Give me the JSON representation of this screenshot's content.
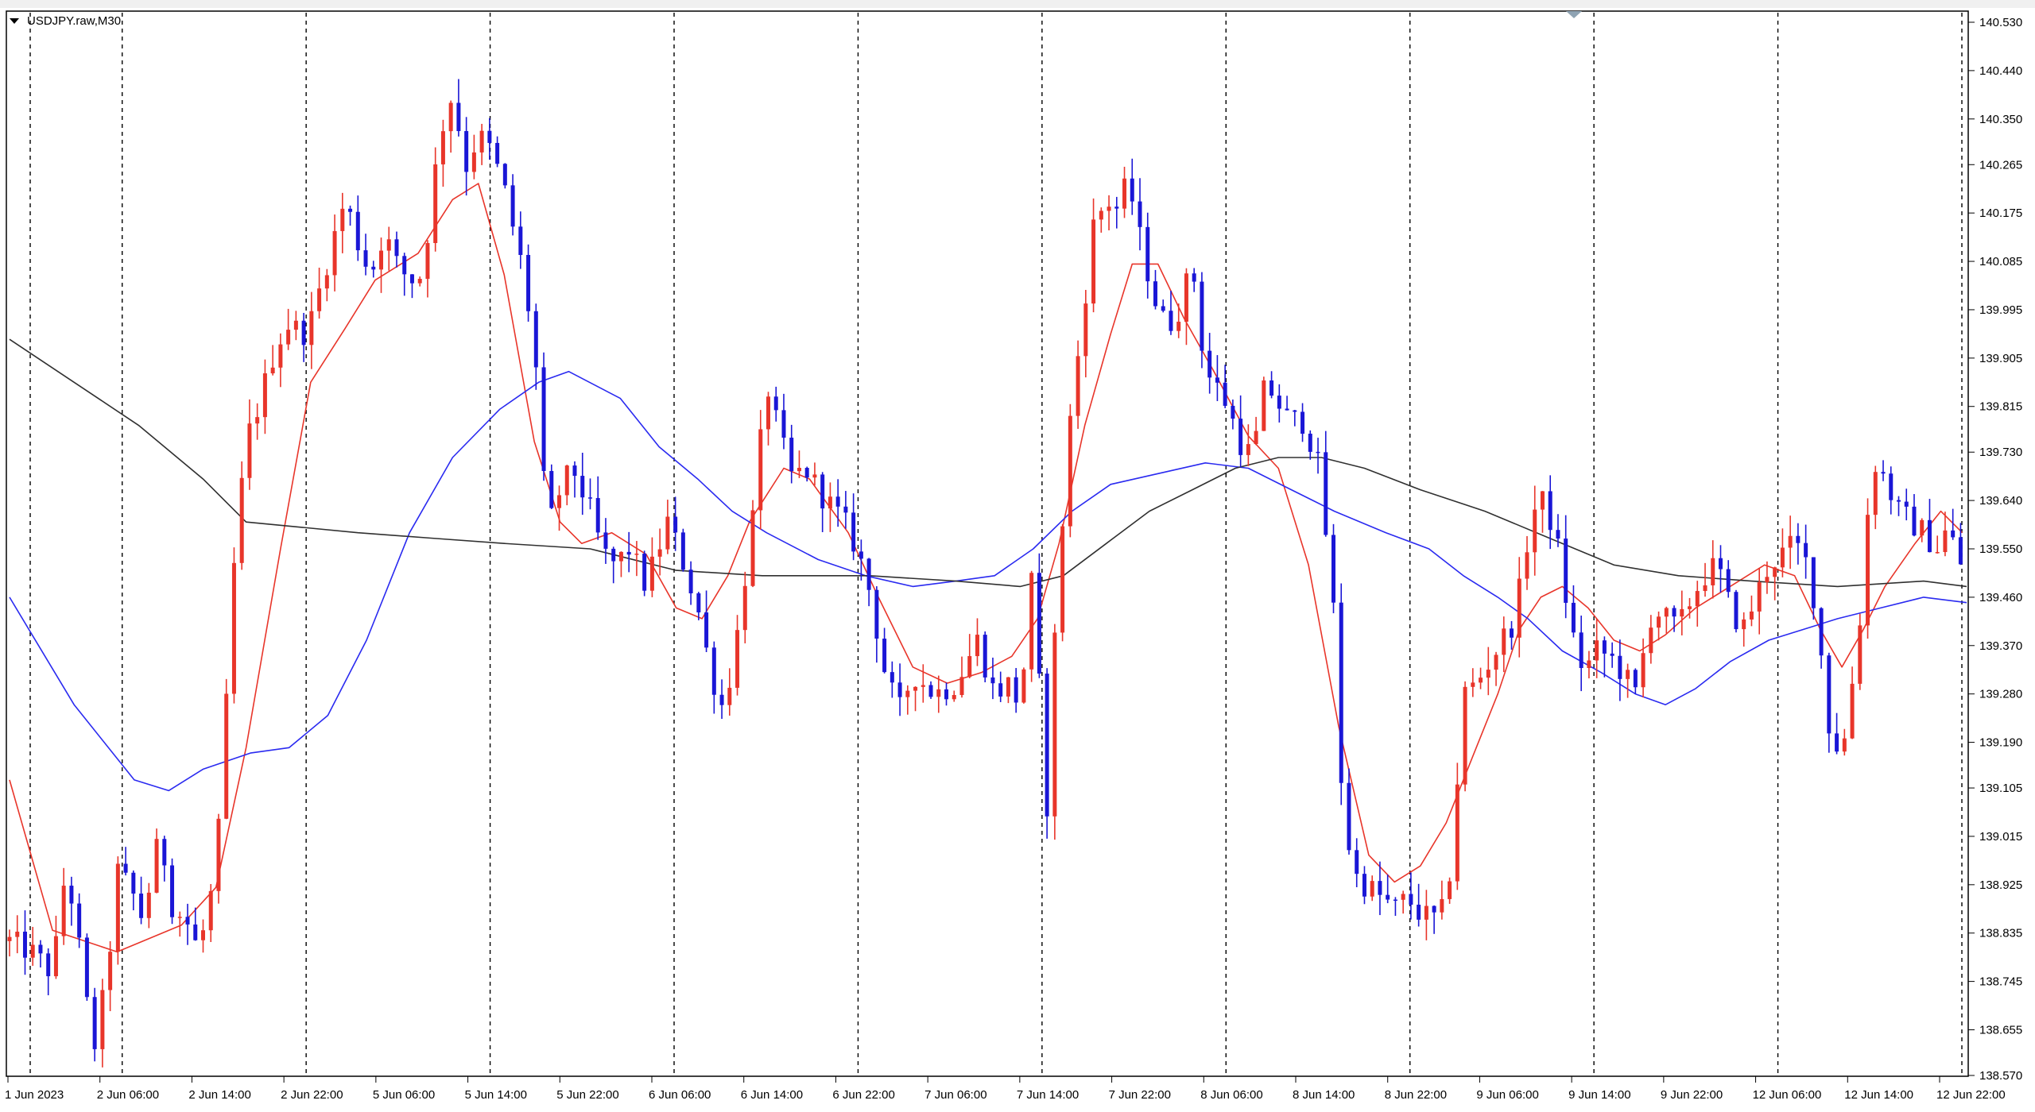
{
  "window": {
    "symbol_title": "USDJPY.raw,M30"
  },
  "colors": {
    "bull": "#e8352a",
    "bear": "#1a16d6",
    "ma_red": "#e8352a",
    "ma_blue": "#2a2af0",
    "ma_black": "#303030",
    "grid": "#000000",
    "background": "#ffffff"
  },
  "chart_data": {
    "type": "candlestick",
    "symbol": "USDJPY.raw",
    "timeframe": "M30",
    "ylim": [
      138.57,
      140.53
    ],
    "grid": false,
    "y_ticks": [
      "140.530",
      "140.440",
      "140.350",
      "140.265",
      "140.175",
      "140.085",
      "139.995",
      "139.905",
      "139.815",
      "139.730",
      "139.640",
      "139.550",
      "139.460",
      "139.370",
      "139.280",
      "139.190",
      "139.105",
      "139.015",
      "138.925",
      "138.835",
      "138.745",
      "138.655",
      "138.570"
    ],
    "x_ticks": [
      "1 Jun 2023",
      "2 Jun 06:00",
      "2 Jun 14:00",
      "2 Jun 22:00",
      "5 Jun 06:00",
      "5 Jun 14:00",
      "5 Jun 22:00",
      "6 Jun 06:00",
      "6 Jun 14:00",
      "6 Jun 22:00",
      "7 Jun 06:00",
      "7 Jun 14:00",
      "7 Jun 22:00",
      "8 Jun 06:00",
      "8 Jun 14:00",
      "8 Jun 22:00",
      "9 Jun 06:00",
      "9 Jun 14:00",
      "9 Jun 22:00",
      "12 Jun 06:00",
      "12 Jun 14:00",
      "12 Jun 22:00"
    ],
    "period_separators": [
      "1 Jun 2023",
      "2 Jun 06:00",
      "2 Jun 22:00",
      "5 Jun 14:00",
      "6 Jun 06:00",
      "6 Jun 22:00",
      "7 Jun 14:00",
      "8 Jun 06:00",
      "8 Jun 22:00",
      "9 Jun 14:00",
      "12 Jun 06:00",
      "12 Jun 22:00"
    ],
    "close_path": [
      [
        0,
        138.82
      ],
      [
        10,
        138.8
      ],
      [
        20,
        138.76
      ],
      [
        26,
        138.95
      ],
      [
        30,
        138.88
      ],
      [
        36,
        138.7
      ],
      [
        40,
        138.62
      ],
      [
        46,
        138.78
      ],
      [
        50,
        138.95
      ],
      [
        56,
        138.92
      ],
      [
        62,
        138.86
      ],
      [
        70,
        139.02
      ],
      [
        76,
        138.88
      ],
      [
        82,
        138.86
      ],
      [
        88,
        138.8
      ],
      [
        96,
        138.95
      ],
      [
        100,
        139.2
      ],
      [
        104,
        139.5
      ],
      [
        110,
        139.75
      ],
      [
        116,
        139.82
      ],
      [
        124,
        139.93
      ],
      [
        130,
        139.97
      ],
      [
        136,
        139.95
      ],
      [
        140,
        139.97
      ],
      [
        148,
        140.09
      ],
      [
        156,
        140.2
      ],
      [
        162,
        140.12
      ],
      [
        168,
        140.06
      ],
      [
        174,
        140.14
      ],
      [
        180,
        140.08
      ],
      [
        186,
        140.05
      ],
      [
        192,
        140.06
      ],
      [
        200,
        140.32
      ],
      [
        206,
        140.4
      ],
      [
        212,
        140.26
      ],
      [
        218,
        140.32
      ],
      [
        224,
        140.29
      ],
      [
        230,
        140.22
      ],
      [
        238,
        140.08
      ],
      [
        244,
        139.93
      ],
      [
        250,
        139.58
      ],
      [
        256,
        139.66
      ],
      [
        262,
        139.7
      ],
      [
        270,
        139.62
      ],
      [
        276,
        139.54
      ],
      [
        282,
        139.52
      ],
      [
        288,
        139.55
      ],
      [
        296,
        139.48
      ],
      [
        300,
        139.53
      ],
      [
        306,
        139.6
      ],
      [
        312,
        139.54
      ],
      [
        320,
        139.44
      ],
      [
        326,
        139.32
      ],
      [
        332,
        139.25
      ],
      [
        338,
        139.38
      ],
      [
        346,
        139.62
      ],
      [
        352,
        139.86
      ],
      [
        358,
        139.76
      ],
      [
        364,
        139.68
      ],
      [
        370,
        139.7
      ],
      [
        376,
        139.66
      ],
      [
        382,
        139.63
      ],
      [
        388,
        139.6
      ],
      [
        394,
        139.55
      ],
      [
        400,
        139.47
      ],
      [
        408,
        139.3
      ],
      [
        414,
        139.25
      ],
      [
        420,
        139.32
      ],
      [
        430,
        139.28
      ],
      [
        440,
        139.3
      ],
      [
        450,
        139.38
      ],
      [
        458,
        139.28
      ],
      [
        464,
        139.3
      ],
      [
        470,
        139.26
      ],
      [
        476,
        139.52
      ],
      [
        482,
        139.04
      ],
      [
        486,
        139.38
      ],
      [
        492,
        139.75
      ],
      [
        498,
        139.95
      ],
      [
        504,
        140.15
      ],
      [
        510,
        140.2
      ],
      [
        516,
        140.18
      ],
      [
        520,
        140.24
      ],
      [
        526,
        140.12
      ],
      [
        532,
        140.02
      ],
      [
        538,
        139.96
      ],
      [
        544,
        140.0
      ],
      [
        550,
        140.08
      ],
      [
        556,
        139.88
      ],
      [
        560,
        139.86
      ],
      [
        566,
        139.82
      ],
      [
        572,
        139.75
      ],
      [
        578,
        139.72
      ],
      [
        584,
        139.86
      ],
      [
        590,
        139.82
      ],
      [
        596,
        139.78
      ],
      [
        600,
        139.8
      ],
      [
        604,
        139.76
      ],
      [
        608,
        139.72
      ],
      [
        612,
        139.58
      ],
      [
        616,
        139.42
      ],
      [
        620,
        139.05
      ],
      [
        626,
        138.94
      ],
      [
        632,
        138.92
      ],
      [
        638,
        138.9
      ],
      [
        644,
        138.88
      ],
      [
        650,
        138.9
      ],
      [
        656,
        138.87
      ],
      [
        662,
        138.86
      ],
      [
        668,
        138.88
      ],
      [
        672,
        139.05
      ],
      [
        676,
        139.28
      ],
      [
        682,
        139.3
      ],
      [
        688,
        139.34
      ],
      [
        694,
        139.38
      ],
      [
        700,
        139.42
      ],
      [
        708,
        139.62
      ],
      [
        714,
        139.64
      ],
      [
        720,
        139.55
      ],
      [
        726,
        139.4
      ],
      [
        732,
        139.32
      ],
      [
        738,
        139.36
      ],
      [
        744,
        139.35
      ],
      [
        750,
        139.32
      ],
      [
        756,
        139.28
      ],
      [
        764,
        139.44
      ],
      [
        770,
        139.42
      ],
      [
        776,
        139.4
      ],
      [
        782,
        139.46
      ],
      [
        788,
        139.5
      ],
      [
        794,
        139.52
      ],
      [
        800,
        139.44
      ],
      [
        806,
        139.4
      ],
      [
        812,
        139.46
      ],
      [
        818,
        139.52
      ],
      [
        824,
        139.54
      ],
      [
        830,
        139.56
      ],
      [
        836,
        139.52
      ],
      [
        840,
        139.44
      ],
      [
        846,
        139.22
      ],
      [
        852,
        139.16
      ],
      [
        856,
        139.28
      ],
      [
        860,
        139.4
      ],
      [
        866,
        139.72
      ],
      [
        872,
        139.68
      ],
      [
        878,
        139.62
      ],
      [
        884,
        139.6
      ],
      [
        890,
        139.58
      ],
      [
        896,
        139.55
      ],
      [
        900,
        139.58
      ],
      [
        906,
        139.55
      ],
      [
        910,
        139.46
      ]
    ],
    "moving_averages": [
      {
        "color": "red",
        "role": "fast",
        "points": [
          [
            0,
            139.12
          ],
          [
            20,
            138.84
          ],
          [
            50,
            138.8
          ],
          [
            80,
            138.85
          ],
          [
            96,
            138.92
          ],
          [
            110,
            139.18
          ],
          [
            126,
            139.55
          ],
          [
            140,
            139.86
          ],
          [
            156,
            139.96
          ],
          [
            170,
            140.05
          ],
          [
            190,
            140.1
          ],
          [
            206,
            140.2
          ],
          [
            218,
            140.23
          ],
          [
            230,
            140.06
          ],
          [
            244,
            139.75
          ],
          [
            256,
            139.6
          ],
          [
            266,
            139.56
          ],
          [
            280,
            139.58
          ],
          [
            296,
            139.54
          ],
          [
            310,
            139.44
          ],
          [
            322,
            139.42
          ],
          [
            334,
            139.5
          ],
          [
            344,
            139.6
          ],
          [
            360,
            139.7
          ],
          [
            372,
            139.68
          ],
          [
            390,
            139.58
          ],
          [
            404,
            139.46
          ],
          [
            420,
            139.33
          ],
          [
            436,
            139.3
          ],
          [
            452,
            139.32
          ],
          [
            466,
            139.35
          ],
          [
            478,
            139.42
          ],
          [
            488,
            139.56
          ],
          [
            500,
            139.78
          ],
          [
            512,
            139.95
          ],
          [
            522,
            140.08
          ],
          [
            534,
            140.08
          ],
          [
            546,
            139.98
          ],
          [
            560,
            139.88
          ],
          [
            576,
            139.76
          ],
          [
            590,
            139.7
          ],
          [
            604,
            139.52
          ],
          [
            618,
            139.22
          ],
          [
            632,
            138.98
          ],
          [
            644,
            138.93
          ],
          [
            656,
            138.96
          ],
          [
            668,
            139.04
          ],
          [
            680,
            139.16
          ],
          [
            692,
            139.28
          ],
          [
            702,
            139.4
          ],
          [
            712,
            139.46
          ],
          [
            722,
            139.48
          ],
          [
            734,
            139.44
          ],
          [
            746,
            139.38
          ],
          [
            758,
            139.36
          ],
          [
            770,
            139.39
          ],
          [
            784,
            139.44
          ],
          [
            800,
            139.48
          ],
          [
            816,
            139.52
          ],
          [
            830,
            139.5
          ],
          [
            842,
            139.4
          ],
          [
            852,
            139.33
          ],
          [
            862,
            139.4
          ],
          [
            872,
            139.48
          ],
          [
            886,
            139.56
          ],
          [
            898,
            139.62
          ],
          [
            908,
            139.58
          ]
        ]
      },
      {
        "color": "blue",
        "role": "medium",
        "points": [
          [
            0,
            139.46
          ],
          [
            30,
            139.26
          ],
          [
            58,
            139.12
          ],
          [
            74,
            139.1
          ],
          [
            90,
            139.14
          ],
          [
            112,
            139.17
          ],
          [
            130,
            139.18
          ],
          [
            148,
            139.24
          ],
          [
            166,
            139.38
          ],
          [
            186,
            139.58
          ],
          [
            206,
            139.72
          ],
          [
            228,
            139.81
          ],
          [
            246,
            139.86
          ],
          [
            260,
            139.88
          ],
          [
            284,
            139.83
          ],
          [
            302,
            139.74
          ],
          [
            320,
            139.68
          ],
          [
            336,
            139.62
          ],
          [
            352,
            139.58
          ],
          [
            376,
            139.53
          ],
          [
            398,
            139.5
          ],
          [
            420,
            139.48
          ],
          [
            440,
            139.49
          ],
          [
            458,
            139.5
          ],
          [
            476,
            139.55
          ],
          [
            494,
            139.62
          ],
          [
            512,
            139.67
          ],
          [
            534,
            139.69
          ],
          [
            556,
            139.71
          ],
          [
            576,
            139.7
          ],
          [
            596,
            139.66
          ],
          [
            616,
            139.62
          ],
          [
            640,
            139.58
          ],
          [
            660,
            139.55
          ],
          [
            676,
            139.5
          ],
          [
            692,
            139.46
          ],
          [
            706,
            139.42
          ],
          [
            722,
            139.36
          ],
          [
            740,
            139.32
          ],
          [
            756,
            139.28
          ],
          [
            770,
            139.26
          ],
          [
            784,
            139.29
          ],
          [
            800,
            139.34
          ],
          [
            818,
            139.38
          ],
          [
            834,
            139.4
          ],
          [
            850,
            139.42
          ],
          [
            870,
            139.44
          ],
          [
            890,
            139.46
          ],
          [
            910,
            139.45
          ]
        ]
      },
      {
        "color": "black",
        "role": "slow",
        "points": [
          [
            0,
            139.94
          ],
          [
            30,
            139.86
          ],
          [
            60,
            139.78
          ],
          [
            90,
            139.68
          ],
          [
            110,
            139.6
          ],
          [
            136,
            139.59
          ],
          [
            162,
            139.58
          ],
          [
            196,
            139.57
          ],
          [
            230,
            139.56
          ],
          [
            270,
            139.55
          ],
          [
            310,
            139.51
          ],
          [
            350,
            139.5
          ],
          [
            400,
            139.5
          ],
          [
            440,
            139.49
          ],
          [
            470,
            139.48
          ],
          [
            490,
            139.5
          ],
          [
            510,
            139.56
          ],
          [
            530,
            139.62
          ],
          [
            550,
            139.66
          ],
          [
            570,
            139.7
          ],
          [
            590,
            139.72
          ],
          [
            610,
            139.72
          ],
          [
            630,
            139.7
          ],
          [
            656,
            139.66
          ],
          [
            686,
            139.62
          ],
          [
            716,
            139.57
          ],
          [
            746,
            139.52
          ],
          [
            776,
            139.5
          ],
          [
            810,
            139.49
          ],
          [
            850,
            139.48
          ],
          [
            890,
            139.49
          ],
          [
            910,
            139.48
          ]
        ]
      }
    ]
  }
}
